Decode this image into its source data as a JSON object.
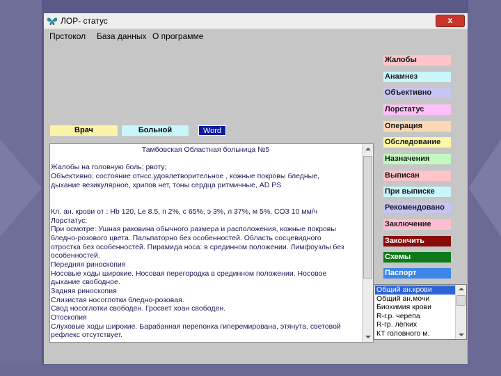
{
  "window": {
    "title": "ЛОР- статус",
    "close_label": "x"
  },
  "menu": [
    "Прстокол",
    "База данных",
    "О программе"
  ],
  "fields": {
    "doctor_label": "Врач",
    "patient_label": "Больной",
    "word_label": "Word"
  },
  "document": {
    "lines": [
      "Тамбовская Областная больница №5",
      "",
      "Жалобы на головную боль; рвоту;",
      "Объективно: состояние  отнсс.удовлетворительное ,  кожные покровы  бледные,",
      "дыхание  везикулярное, хрипов нет,   тоны сердца  ритмичные, AD      PS",
      "",
      "",
      "Кл. ан. крови от      : Hb 120, Le 8.5, п 2%, с 65%, э 3%, л 37%, м 5%, СОЗ 10 мм/ч",
      "Лорстатус:",
      "При осмотре: Ушная раковина обычного размера и расположения, кожные покровы",
      "бледно-розового цвета. Пальпаторно без особенностей. Область сосцевидного",
      "отростка без особенностей. Пирамида носа: в срединном  положении. Лимфоузлы без",
      "особенностей.",
      "Передняя риноскопия",
      "Носовые ходы широкие.  Носовая перегородка в срединном положении.  Носовое",
      "дыхание свободное.",
      "Задняя риноскопия",
      "Слизистая носоглотки бледно-розовая.",
      "Свод носоглотки свободен. Гросвет хоан свободен.",
      "Отоскопия",
      "Слуховые ходы широкие. Барабанная перепонка гиперемирована, этянута, световой",
      "рефлекс отсутствует."
    ]
  },
  "side_buttons": [
    {
      "label": "Жалобы",
      "bg": "#ffc4c8",
      "color": "#1a1a1a"
    },
    {
      "label": "Анамнез",
      "bg": "#c8f6fb",
      "color": "#1a1a1a"
    },
    {
      "label": "Объективно",
      "bg": "#c7c4f6",
      "color": "#1a1a1a"
    },
    {
      "label": "Лорстатус",
      "bg": "#ffbff7",
      "color": "#1a1a1a"
    },
    {
      "label": "Операция",
      "bg": "#fbd8b6",
      "color": "#1a1a1a"
    },
    {
      "label": "Обследование",
      "bg": "#fbf7a8",
      "color": "#1a1a1a"
    },
    {
      "label": "Назначения",
      "bg": "#c3f9c0",
      "color": "#1a1a1a"
    },
    {
      "label": "Выписан",
      "bg": "#ffc4c8",
      "color": "#1a1a1a"
    },
    {
      "label": "При выписке",
      "bg": "#c8f6fb",
      "color": "#1a1a1a"
    },
    {
      "label": "Рекомендовано",
      "bg": "#c7c4f6",
      "color": "#1a1a1a"
    },
    {
      "label": "Заключение",
      "bg": "#ffbfd0",
      "color": "#1a1a1a"
    },
    {
      "label": "Закончить",
      "bg": "#8a0b0b",
      "color": "#ffffff"
    },
    {
      "label": "Схемы",
      "bg": "#0d7a1a",
      "color": "#ffffff"
    },
    {
      "label": "Паспорт",
      "bg": "#3d86e8",
      "color": "#ffffff"
    }
  ],
  "analysis_list": {
    "items": [
      "Общий ан.крови",
      "Общий ан.мочи",
      "Биохимия крови",
      "R-г.р. черепа",
      "R-гр. лёгких",
      "КТ головного м."
    ],
    "selected": 0
  },
  "colors": {
    "doctor_bg": "#fbf3a6",
    "patient_bg": "#c8f6fb",
    "word_bg": "#0b1a9e",
    "selection": "#2e63d6"
  },
  "icons": {
    "app_icon": "butterfly-icon"
  }
}
